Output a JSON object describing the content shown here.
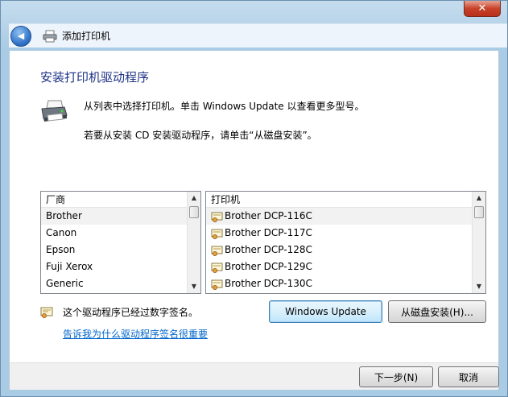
{
  "window": {
    "title": "添加打印机",
    "close_glyph": "✕",
    "back_glyph": "◀"
  },
  "content": {
    "heading": "安装打印机驱动程序",
    "description_line1": "从列表中选择打印机。单击 Windows Update 以查看更多型号。",
    "description_line2": "若要从安装 CD 安装驱动程序，请单击“从磁盘安装”。"
  },
  "manufacturers": {
    "header": "厂商",
    "items": [
      "Brother",
      "Canon",
      "Epson",
      "Fuji Xerox",
      "Generic"
    ],
    "selected": "Brother"
  },
  "printers": {
    "header": "打印机",
    "items": [
      "Brother DCP-116C",
      "Brother DCP-117C",
      "Brother DCP-128C",
      "Brother DCP-129C",
      "Brother DCP-130C"
    ],
    "selected": "Brother DCP-116C"
  },
  "buttons": {
    "windows_update": "Windows Update",
    "have_disk": "从磁盘安装(H)...",
    "next": "下一步(N)",
    "cancel": "取消"
  },
  "signature": {
    "text": "这个驱动程序已经过数字签名。",
    "link": "告诉我为什么驱动程序签名很重要"
  },
  "icons": {
    "back": "back-arrow-icon",
    "printer_small": "printer-icon",
    "printer_large": "printer-icon",
    "driver": "printer-driver-icon",
    "certificate": "certificate-icon"
  },
  "colors": {
    "heading": "#1e3287",
    "link": "#0066cc",
    "frame": "#a9cbe4"
  }
}
